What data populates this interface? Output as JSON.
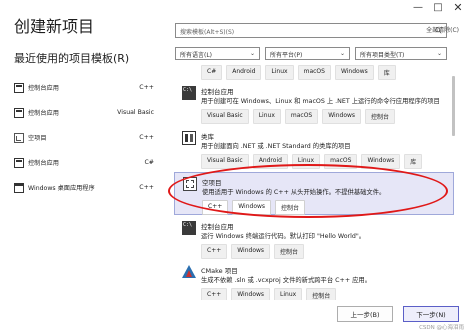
{
  "window": {
    "minimize_label": "—",
    "maximize_label": "□",
    "close_label": "✕"
  },
  "page_title": "创建新项目",
  "recent": {
    "title": "最近使用的项目模板(R)",
    "items": [
      {
        "name": "控制台应用",
        "lang": "C++",
        "icon": "console-icon"
      },
      {
        "name": "控制台应用",
        "lang": "Visual Basic",
        "icon": "console-icon"
      },
      {
        "name": "空项目",
        "lang": "C++",
        "icon": "empty-project-icon"
      },
      {
        "name": "控制台应用",
        "lang": "C#",
        "icon": "console-icon"
      },
      {
        "name": "Windows 桌面应用程序",
        "lang": "C++",
        "icon": "desktop-app-icon"
      }
    ]
  },
  "search": {
    "placeholder": "搜索模板(Alt+S)(S)"
  },
  "clear_all": "全部清除(C)",
  "filters": {
    "language": "所有语言(L)",
    "platform": "所有平台(P)",
    "project_type": "所有项目类型(T)"
  },
  "templates": [
    {
      "name": "",
      "desc": "",
      "tags": [
        "C#",
        "Android",
        "Linux",
        "macOS",
        "Windows",
        "库"
      ],
      "partial": true
    },
    {
      "name": "控制台应用",
      "desc": "用于创建可在 Windows、Linux 和 macOS 上 .NET 上运行的命令行应用程序的项目",
      "tags": [
        "Visual Basic",
        "Linux",
        "macOS",
        "Windows",
        "控制台"
      ],
      "icon": "console-icon"
    },
    {
      "name": "类库",
      "desc": "用于创建面向 .NET 或 .NET Standard 的类库的项目",
      "tags": [
        "Visual Basic",
        "Android",
        "Linux",
        "macOS",
        "Windows",
        "库"
      ],
      "icon": "library-icon"
    },
    {
      "name": "空项目",
      "desc": "使用适用于 Windows 的 C++ 从头开始操作。不提供基础文件。",
      "tags": [
        "C++",
        "Windows",
        "控制台"
      ],
      "icon": "empty-project-icon",
      "selected": true
    },
    {
      "name": "控制台应用",
      "desc": "运行 Windows 终端运行代码。默认打印 \"Hello World\"。",
      "tags": [
        "C++",
        "Windows",
        "控制台"
      ],
      "icon": "console-icon"
    },
    {
      "name": "CMake 项目",
      "desc": "生成不依赖 .sln 或 .vcxproj 文件的新式跨平台 C++ 应用。",
      "tags": [
        "C++",
        "Windows",
        "Linux",
        "控制台"
      ],
      "icon": "cmake-icon"
    }
  ],
  "buttons": {
    "back": "上一步(B)",
    "next": "下一步(N)"
  },
  "watermark": "CSDN @心海泪雨",
  "colors": {
    "selected_bg": "#e6e6f7",
    "annotation_red": "#e01818",
    "primary_border": "#5b5fc7"
  }
}
